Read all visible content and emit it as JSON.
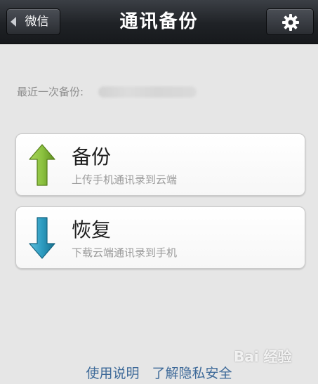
{
  "navbar": {
    "back_label": "微信",
    "title": "通讯备份",
    "settings_icon": "gear-icon"
  },
  "last_backup": {
    "label": "最近一次备份:"
  },
  "actions": [
    {
      "title": "备份",
      "subtitle": "上传手机通讯录到云端",
      "icon": "up-arrow-icon",
      "color": "#7fb236"
    },
    {
      "title": "恢复",
      "subtitle": "下载云端通讯录到手机",
      "icon": "down-arrow-icon",
      "color": "#2a90b0"
    }
  ],
  "footer": {
    "usage_link": "使用说明",
    "privacy_link": "了解隐私安全"
  },
  "watermark": {
    "text": "Bai 经验"
  },
  "colors": {
    "navbar_bg": "#1f2226",
    "page_bg": "#e6e6e6",
    "link": "#3e6a99"
  }
}
